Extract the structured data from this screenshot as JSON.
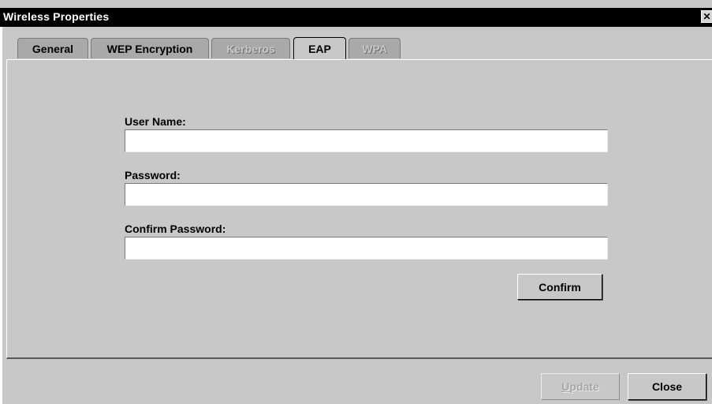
{
  "window": {
    "title": "Wireless Properties",
    "close_glyph": "✕"
  },
  "tabs": [
    {
      "label": "General",
      "state": "normal"
    },
    {
      "label": "WEP Encryption",
      "state": "normal"
    },
    {
      "label": "Kerberos",
      "state": "disabled"
    },
    {
      "label": "EAP",
      "state": "active"
    },
    {
      "label": "WPA",
      "state": "disabled"
    }
  ],
  "form": {
    "username_label": "User Name:",
    "username_value": "",
    "password_label": "Password:",
    "password_value": "",
    "confirm_password_label": "Confirm Password:",
    "confirm_password_value": "",
    "confirm_button": "Confirm"
  },
  "footer": {
    "update_mnemonic": "U",
    "update_rest": "pdate",
    "close_button": "Close"
  }
}
